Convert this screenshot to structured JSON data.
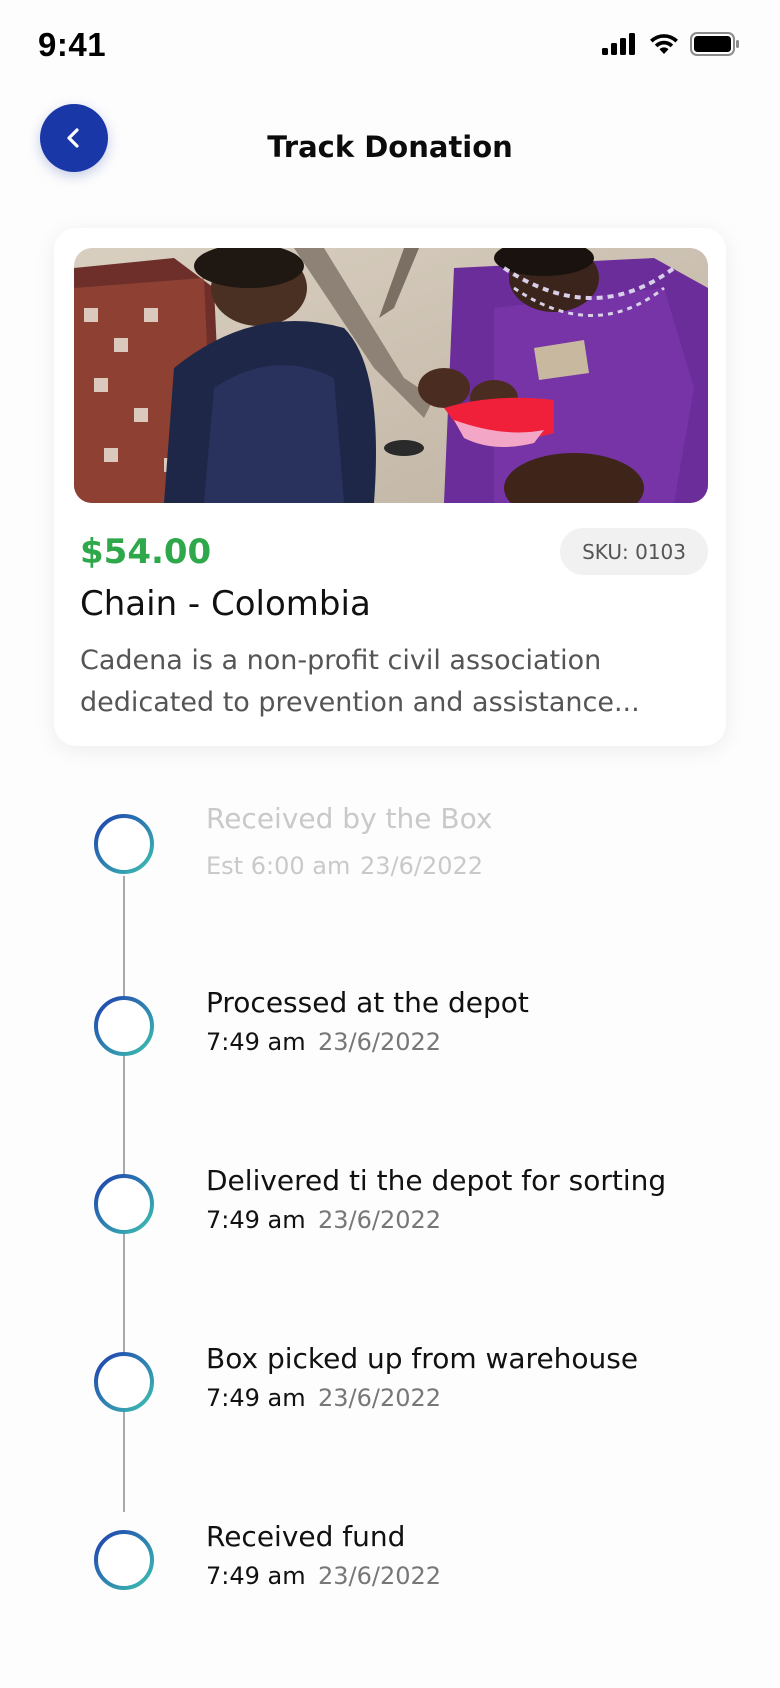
{
  "status_bar": {
    "time": "9:41",
    "icons": [
      "cellular-signal-icon",
      "wifi-icon",
      "battery-icon"
    ]
  },
  "header": {
    "back_icon": "chevron-left-icon",
    "title": "Track Donation"
  },
  "donation_card": {
    "price": "$54.00",
    "sku": "SKU: 0103",
    "title": "Chain - Colombia",
    "description_line1": "Cadena is a non-profit civil association",
    "description_line2": "dedicated to prevention and assistance..."
  },
  "timeline": {
    "steps": [
      {
        "title": "Received by the Box",
        "time": "Est 6:00  am",
        "date": "23/6/2022",
        "state": "pending"
      },
      {
        "title": "Processed at the depot",
        "time": "7:49 am",
        "date": "23/6/2022",
        "state": "done"
      },
      {
        "title": "Delivered ti the depot for sorting",
        "time": "7:49 am",
        "date": "23/6/2022",
        "state": "done"
      },
      {
        "title": "Box picked up from warehouse",
        "time": "7:49 am",
        "date": "23/6/2022",
        "state": "done"
      },
      {
        "title": "Received fund",
        "time": "7:49 am",
        "date": "23/6/2022",
        "state": "done"
      }
    ]
  },
  "colors": {
    "primary": "#1a37a8",
    "price_green": "#2ea84a",
    "ring_gradient_start": "#1f3fb0",
    "ring_gradient_end": "#3cc0b0"
  }
}
